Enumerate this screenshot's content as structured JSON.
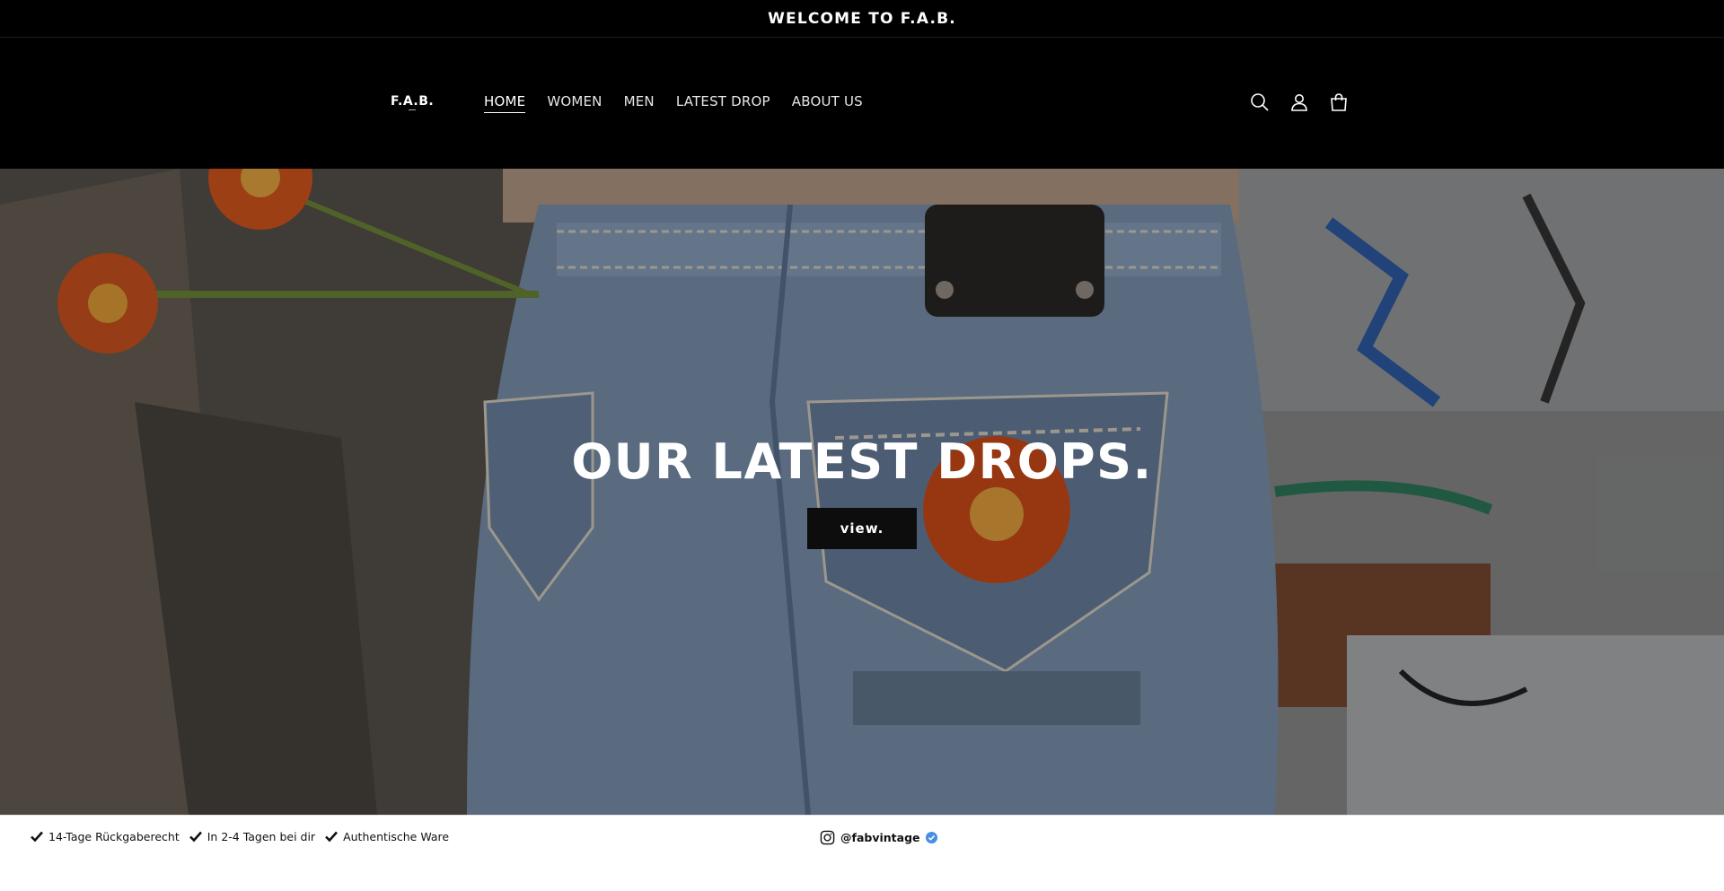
{
  "announcement": {
    "text": "WELCOME TO F.A.B."
  },
  "header": {
    "logo_text": "F.A.B.",
    "nav": [
      {
        "label": "HOME",
        "active": true
      },
      {
        "label": "WOMEN",
        "active": false
      },
      {
        "label": "MEN",
        "active": false
      },
      {
        "label": "LATEST DROP",
        "active": false
      },
      {
        "label": "ABOUT US",
        "active": false
      }
    ],
    "icons": [
      "search-icon",
      "account-icon",
      "cart-icon"
    ]
  },
  "hero": {
    "heading": "OUR LATEST DROPS.",
    "button_label": "view."
  },
  "trust_bar": {
    "items": [
      "14-Tage Rückgaberecht",
      "In 2-4 Tagen bei dir",
      "Authentische Ware"
    ],
    "instagram_handle": "@fabvintage"
  },
  "colors": {
    "header_bg": "#000000",
    "hero_button_bg": "#0d0d0d",
    "verified_badge": "#4a90e2"
  }
}
